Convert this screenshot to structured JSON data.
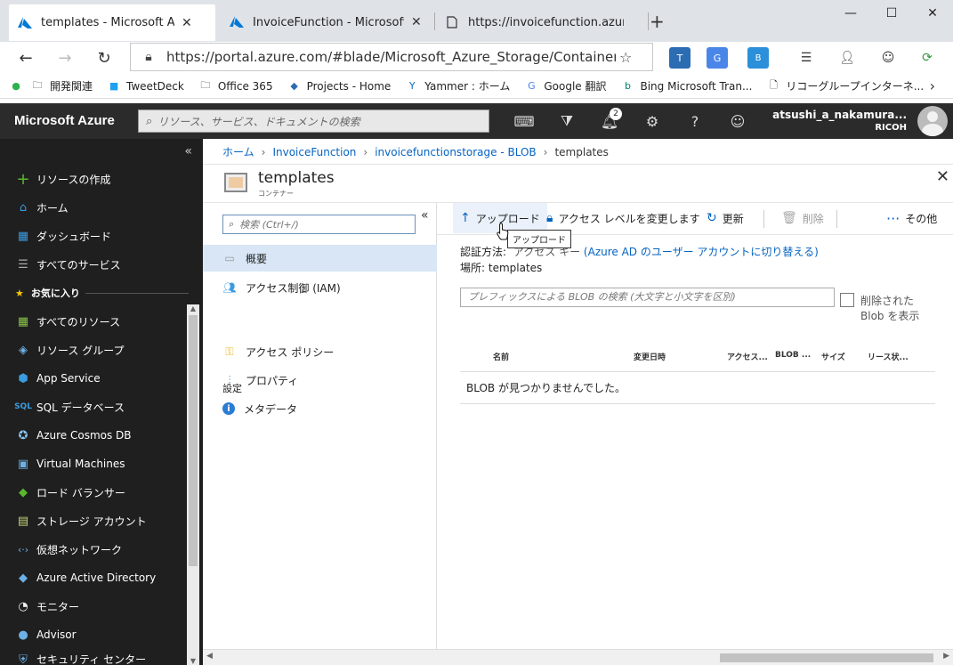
{
  "browser": {
    "tabs": [
      {
        "label": "templates - Microsoft Azure",
        "close": "✕"
      },
      {
        "label": "InvoiceFunction - Microsoft Azure",
        "close": "✕"
      },
      {
        "label": "https://invoicefunction.azureweb",
        "close": ""
      }
    ],
    "new_tab": "+",
    "window_controls": [
      "—",
      "☐",
      "✕"
    ],
    "url": "https://portal.azure.com/#blade/Microsoft_Azure_Storage/Container...",
    "bookmarks": [
      "開発関連",
      "TweetDeck",
      "Office 365",
      "Projects - Home",
      "Yammer : ホーム",
      "Google 翻訳",
      "Bing Microsoft Tran...",
      "リコーグループインターネ..."
    ]
  },
  "azure": {
    "brand": "Microsoft Azure",
    "search_placeholder": "リソース、サービス、ドキュメントの検索",
    "notification_count": "2",
    "user_name": "atsushi_a_nakamura...",
    "tenant": "RICOH"
  },
  "nav": {
    "create": "リソースの作成",
    "home": "ホーム",
    "dashboard": "ダッシュボード",
    "all_services": "すべてのサービス",
    "favorites": "お気に入り",
    "items": [
      "すべてのリソース",
      "リソース グループ",
      "App Service",
      "SQL データベース",
      "Azure Cosmos DB",
      "Virtual Machines",
      "ロード バランサー",
      "ストレージ アカウント",
      "仮想ネットワーク",
      "Azure Active Directory",
      "モニター",
      "Advisor",
      "セキュリティ センター"
    ]
  },
  "breadcrumb": [
    "ホーム",
    "InvoiceFunction",
    "invoicefunctionstorage - BLOB",
    "templates"
  ],
  "blade": {
    "title": "templates",
    "subtitle": "コンテナー"
  },
  "submenu": {
    "search_placeholder": "検索 (Ctrl+/)",
    "overview": "概要",
    "iam": "アクセス制御 (IAM)",
    "settings_heading": "設定",
    "access_policy": "アクセス ポリシー",
    "properties": "プロパティ",
    "metadata": "メタデータ"
  },
  "toolbar": {
    "upload": "アップロード",
    "change_access": "アクセス レベルを変更します",
    "refresh": "更新",
    "delete": "削除",
    "more": "その他",
    "tooltip": "アップロード"
  },
  "content": {
    "auth_label": "認証方法:",
    "auth_value": "アクセス キー",
    "auth_link": "(Azure AD のユーザー アカウントに切り替える)",
    "location": "場所:  templates",
    "prefix_search_placeholder": "プレフィックスによる BLOB の検索 (大文字と小文字を区別)",
    "show_deleted": "削除された Blob を表示",
    "columns": [
      "名前",
      "変更日時",
      "アクセス...",
      "BLOB ...",
      "サイズ",
      "リース状..."
    ],
    "empty_message": "BLOB が見つかりませんでした。"
  }
}
